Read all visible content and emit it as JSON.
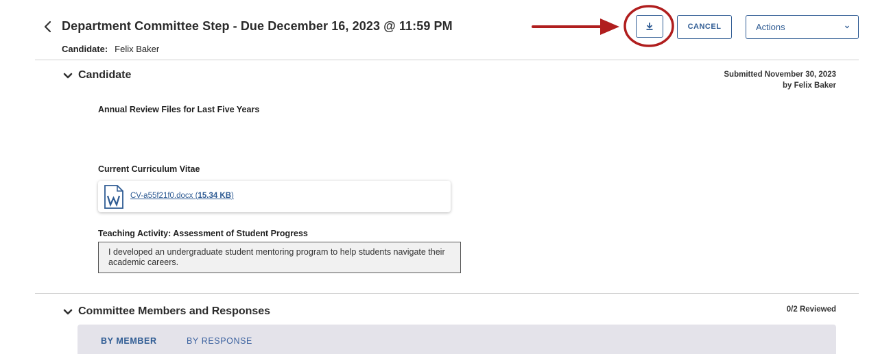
{
  "header": {
    "title": "Department Committee Step - Due December 16, 2023 @ 11:59 PM",
    "candidate_label": "Candidate:",
    "candidate_name": "Felix Baker",
    "cancel_label": "CANCEL",
    "actions_label": "Actions"
  },
  "candidate_section": {
    "title": "Candidate",
    "submitted_line1": "Submitted November 30, 2023",
    "submitted_line2": "by Felix Baker",
    "annual_review_label": "Annual Review Files for Last Five Years",
    "cv_label": "Current Curriculum Vitae",
    "cv_file_name": "CV-a55f21f0.docx",
    "cv_file_size": "15.34 KB",
    "teaching_label": "Teaching Activity: Assessment of Student Progress",
    "teaching_text": "I developed an undergraduate student mentoring program to help students navigate their academic careers."
  },
  "committee_section": {
    "title": "Committee Members and Responses",
    "reviewed_status": "0/2 Reviewed",
    "tabs": [
      {
        "label": "BY MEMBER",
        "active": true
      },
      {
        "label": "BY RESPONSE",
        "active": false
      }
    ]
  },
  "icons": {
    "back": "chevron-left-icon",
    "download": "download-icon",
    "dropdown": "chevron-down-icon",
    "word_doc": "word-document-icon"
  },
  "colors": {
    "accent": "#2e5b93",
    "annotation_red": "#b01e1e"
  }
}
